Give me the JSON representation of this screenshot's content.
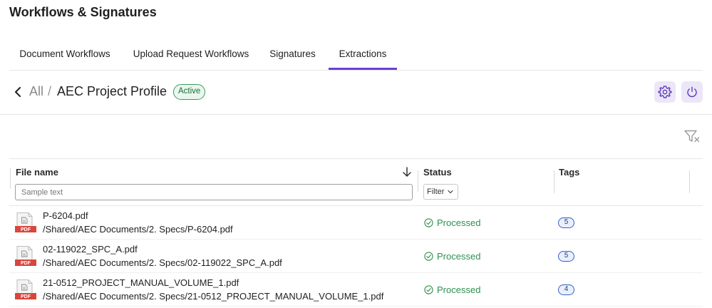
{
  "header": {
    "title": "Workflows & Signatures"
  },
  "tabs": [
    {
      "label": "Document Workflows",
      "active": false
    },
    {
      "label": "Upload Request Workflows",
      "active": false
    },
    {
      "label": "Signatures",
      "active": false
    },
    {
      "label": "Extractions",
      "active": true
    }
  ],
  "breadcrumb": {
    "root": "All",
    "separator": "/",
    "current": "AEC Project Profile",
    "badge": "Active"
  },
  "colors": {
    "accent": "#6a3fd6",
    "success": "#2f8f4e",
    "tag": "#3a5fc4"
  },
  "icons": {
    "back": "chevron-left-icon",
    "settings": "gear-icon",
    "power": "power-icon",
    "clear_filter": "filter-clear-icon",
    "sort": "arrow-down-icon",
    "file": "pdf-file-icon",
    "status": "check-circle-icon"
  },
  "table": {
    "columns": {
      "file_name": "File name",
      "status": "Status",
      "tags": "Tags"
    },
    "search_placeholder": "Sample text",
    "status_filter": "Filter",
    "file_type_label": "PDF",
    "rows": [
      {
        "name": "P-6204.pdf",
        "path": "/Shared/AEC Documents/2. Specs/P-6204.pdf",
        "status": "Processed",
        "tags": "5"
      },
      {
        "name": "02-119022_SPC_A.pdf",
        "path": "/Shared/AEC Documents/2. Specs/02-119022_SPC_A.pdf",
        "status": "Processed",
        "tags": "5"
      },
      {
        "name": "21-0512_PROJECT_MANUAL_VOLUME_1.pdf",
        "path": "/Shared/AEC Documents/2. Specs/21-0512_PROJECT_MANUAL_VOLUME_1.pdf",
        "status": "Processed",
        "tags": "4"
      }
    ]
  }
}
